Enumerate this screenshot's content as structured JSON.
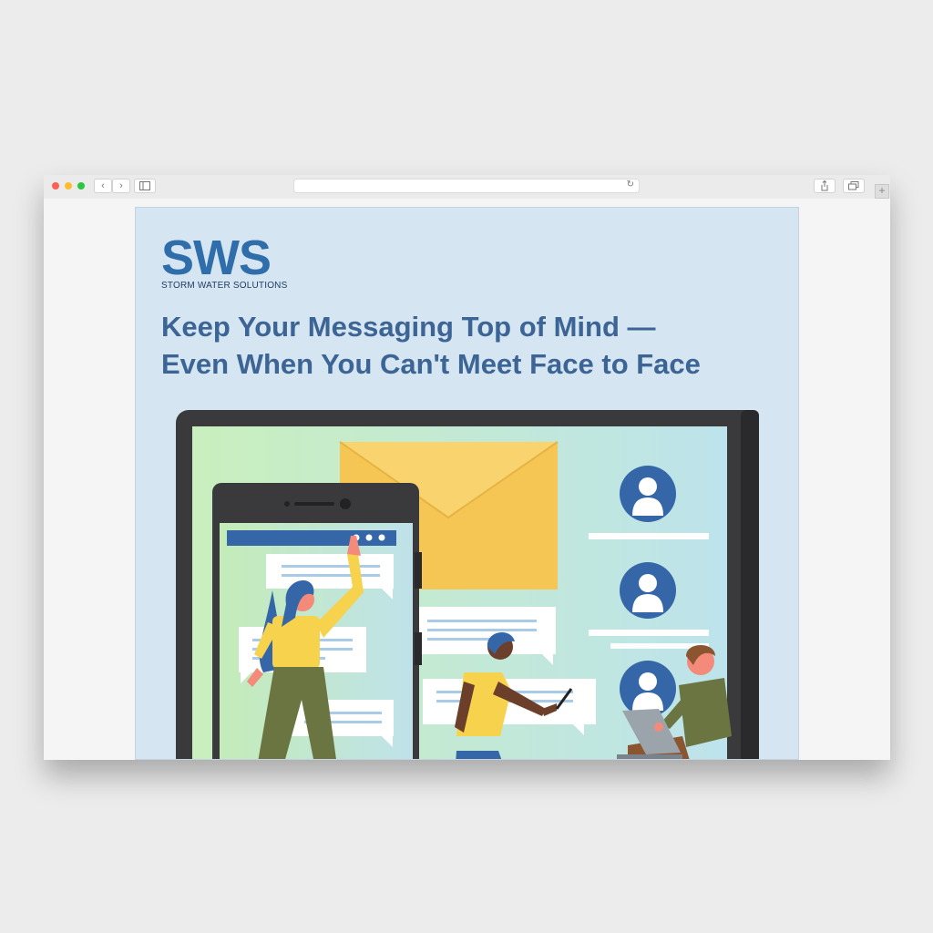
{
  "browser": {
    "traffic_lights": {
      "close": "#ff5f57",
      "minimize": "#febc2e",
      "maximize": "#28c840"
    },
    "nav": {
      "back": "‹",
      "forward": "›",
      "new_tab": "+"
    },
    "address_bar": {
      "value": ""
    }
  },
  "email": {
    "logo": {
      "mark": "SWS",
      "tagline": "STORM WATER SOLUTIONS"
    },
    "headline": {
      "line1": "Keep Your Messaging Top of Mind —",
      "line2": "Even When You Can't Meet Face to Face"
    }
  },
  "colors": {
    "brand_blue": "#2f6eab",
    "headline_blue": "#3c6495",
    "background_blue": "#d5e5f1",
    "envelope_yellow": "#f5c654",
    "avatar_blue": "#3567a8"
  }
}
